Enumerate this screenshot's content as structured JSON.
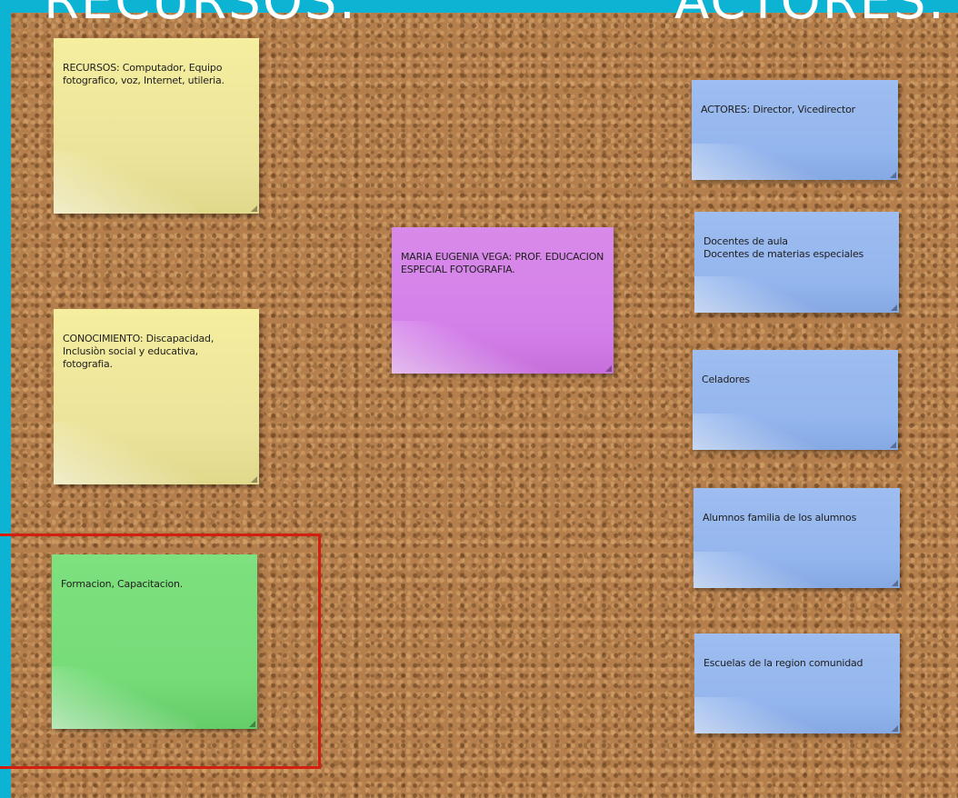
{
  "headings": {
    "left": "RECURSOS:",
    "right": "ACTORES:"
  },
  "colors": {
    "frame": "#0db3d2",
    "cork": "#b57f4d",
    "highlight": "#d41f10",
    "yellow": "#f2eb9e",
    "blue": "#9ebdf0",
    "purple": "#d480ea",
    "green": "#76dc78"
  },
  "notes": {
    "recursos": "RECURSOS: Computador, Equipo fotografico, voz, Internet, utileria.",
    "conocimiento": "CONOCIMIENTO: Discapacidad, Inclusiòn social y educativa, fotografia.",
    "formacion": "Formacion, Capacitacion.",
    "center": "MARIA EUGENIA VEGA: PROF. EDUCACION ESPECIAL FOTOGRAFIA.",
    "actores": "ACTORES: Director, Vicedirector",
    "docentes": "Docentes de aula\nDocentes de materias especiales",
    "celadores": "Celadores",
    "alumnos": "Alumnos familia de los alumnos",
    "escuelas": "Escuelas de la region comunidad"
  },
  "icons": {
    "note_corner": "resize-grip-icon"
  }
}
